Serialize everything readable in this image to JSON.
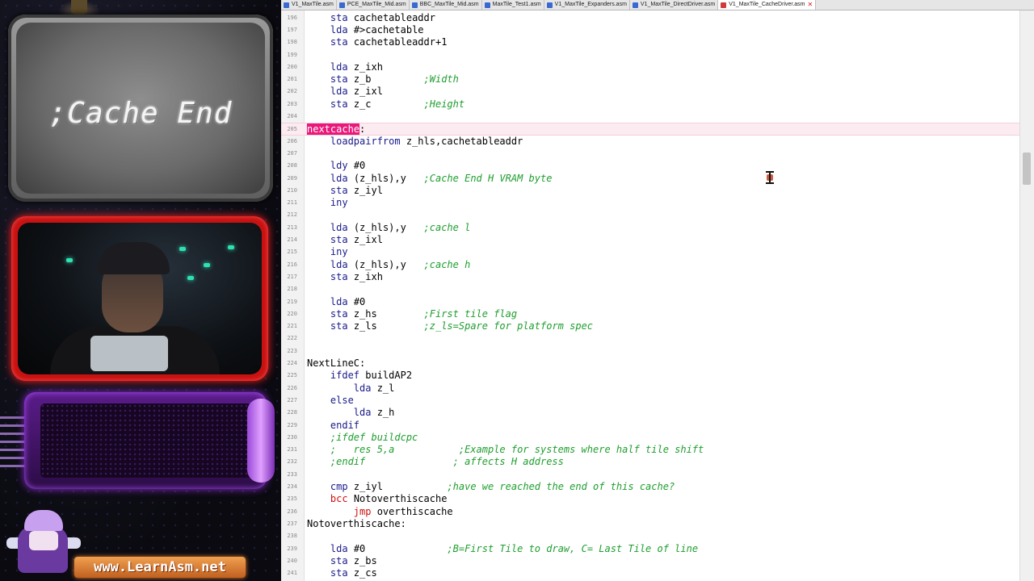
{
  "overlay": {
    "sign_text": ";Cache End",
    "url_text": "www.LearnAsm.net",
    "camera_led_color": "#2fe0b0",
    "camera_frame_color": "#c81212",
    "box_color": "#5a1c8a"
  },
  "editor": {
    "tabs": [
      {
        "label": "V1_MaxTile.asm",
        "active": false
      },
      {
        "label": "PCE_MaxTile_Mid.asm",
        "active": false
      },
      {
        "label": "BBC_MaxTile_Mid.asm",
        "active": false
      },
      {
        "label": "MaxTile_Test1.asm",
        "active": false
      },
      {
        "label": "V1_MaxTile_Expanders.asm",
        "active": false
      },
      {
        "label": "V1_MaxTile_DirectDriver.asm",
        "active": false
      },
      {
        "label": "V1_MaxTile_CacheDriver.asm",
        "active": true
      }
    ],
    "tab_close_glyph": "✕",
    "colors": {
      "keyword": "#1a1a8a",
      "comment": "#1e9e2e",
      "branch": "#d01010",
      "selection": "#e9187a"
    },
    "lines": [
      {
        "n": "196",
        "code": "    sta cachetableaddr"
      },
      {
        "n": "197",
        "code": "    lda #>cachetable"
      },
      {
        "n": "198",
        "code": "    sta cachetableaddr+1"
      },
      {
        "n": "199",
        "code": ""
      },
      {
        "n": "200",
        "code": "    lda z_ixh"
      },
      {
        "n": "201",
        "code": "    sta z_b",
        "comment": ";Width"
      },
      {
        "n": "202",
        "code": "    lda z_ixl"
      },
      {
        "n": "203",
        "code": "    sta z_c",
        "comment": ";Height"
      },
      {
        "n": "204",
        "code": ""
      },
      {
        "n": "205",
        "code": "nextcache:",
        "highlight": true
      },
      {
        "n": "206",
        "code": "    loadpairfrom z_hls,cachetableaddr"
      },
      {
        "n": "207",
        "code": ""
      },
      {
        "n": "208",
        "code": "    ldy #0"
      },
      {
        "n": "209",
        "code": "    lda (z_hls),y",
        "comment": ";Cache End H VRAM byte"
      },
      {
        "n": "210",
        "code": "    sta z_iyl"
      },
      {
        "n": "211",
        "code": "    iny"
      },
      {
        "n": "212",
        "code": ""
      },
      {
        "n": "213",
        "code": "    lda (z_hls),y",
        "comment": ";cache l"
      },
      {
        "n": "214",
        "code": "    sta z_ixl"
      },
      {
        "n": "215",
        "code": "    iny"
      },
      {
        "n": "216",
        "code": "    lda (z_hls),y",
        "comment": ";cache h"
      },
      {
        "n": "217",
        "code": "    sta z_ixh"
      },
      {
        "n": "218",
        "code": ""
      },
      {
        "n": "219",
        "code": "    lda #0"
      },
      {
        "n": "220",
        "code": "    sta z_hs",
        "comment": ";First tile flag"
      },
      {
        "n": "221",
        "code": "    sta z_ls",
        "comment": ";z_ls=Spare for platform spec"
      },
      {
        "n": "222",
        "code": ""
      },
      {
        "n": "223",
        "code": ""
      },
      {
        "n": "224",
        "code": "NextLineC:"
      },
      {
        "n": "225",
        "code": "    ifdef buildAP2"
      },
      {
        "n": "226",
        "code": "        lda z_l"
      },
      {
        "n": "227",
        "code": "    else"
      },
      {
        "n": "228",
        "code": "        lda z_h"
      },
      {
        "n": "229",
        "code": "    endif"
      },
      {
        "n": "230",
        "code": "",
        "comment_only": "    ;ifdef buildcpc"
      },
      {
        "n": "231",
        "code": "",
        "comment_only": "    ;   res 5,a           ;Example for systems where half tile shift"
      },
      {
        "n": "232",
        "code": "",
        "comment_only": "    ;endif               ; affects H address"
      },
      {
        "n": "233",
        "code": ""
      },
      {
        "n": "234",
        "code": "    cmp z_iyl",
        "comment": ";have we reached the end of this cache?"
      },
      {
        "n": "235",
        "code": "    bcc Notoverthiscache"
      },
      {
        "n": "236",
        "code": "        jmp overthiscache"
      },
      {
        "n": "237",
        "code": "Notoverthiscache:"
      },
      {
        "n": "238",
        "code": ""
      },
      {
        "n": "239",
        "code": "    lda #0",
        "comment": ";B=First Tile to draw, C= Last Tile of line"
      },
      {
        "n": "240",
        "code": "    sta z_bs"
      },
      {
        "n": "241",
        "code": "    sta z_cs"
      }
    ]
  }
}
